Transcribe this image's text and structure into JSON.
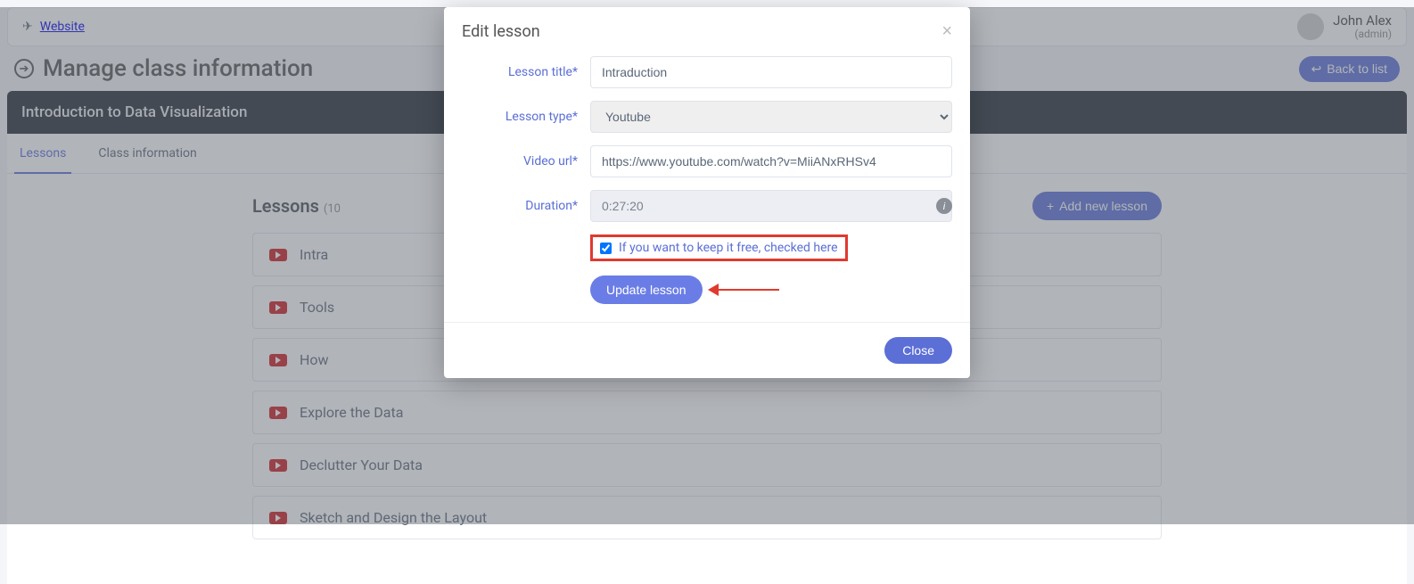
{
  "topbar": {
    "website_label": "Website",
    "user_name": "John Alex",
    "user_role": "(admin)"
  },
  "page": {
    "title": "Manage class information",
    "back_button": "Back to list"
  },
  "class_bar": {
    "title": "Introduction to Data Visualization"
  },
  "tabs": {
    "lessons": "Lessons",
    "class_info": "Class information"
  },
  "lessons": {
    "heading": "Lessons",
    "count_suffix": "(10",
    "add_button": "Add new lesson",
    "items": [
      {
        "title": "Intra"
      },
      {
        "title": "Tools"
      },
      {
        "title": "How"
      },
      {
        "title": "Explore the Data"
      },
      {
        "title": "Declutter Your Data"
      },
      {
        "title": "Sketch and Design the Layout"
      }
    ]
  },
  "modal": {
    "title": "Edit lesson",
    "labels": {
      "lesson_title": "Lesson title*",
      "lesson_type": "Lesson type*",
      "video_url": "Video url*",
      "duration": "Duration*"
    },
    "values": {
      "lesson_title": "Intraduction",
      "lesson_type": "Youtube",
      "video_url": "https://www.youtube.com/watch?v=MiiANxRHSv4",
      "duration": "0:27:20"
    },
    "checkbox_label": "If you want to keep it free, checked here",
    "checkbox_checked": true,
    "update_button": "Update lesson",
    "close_button": "Close"
  }
}
